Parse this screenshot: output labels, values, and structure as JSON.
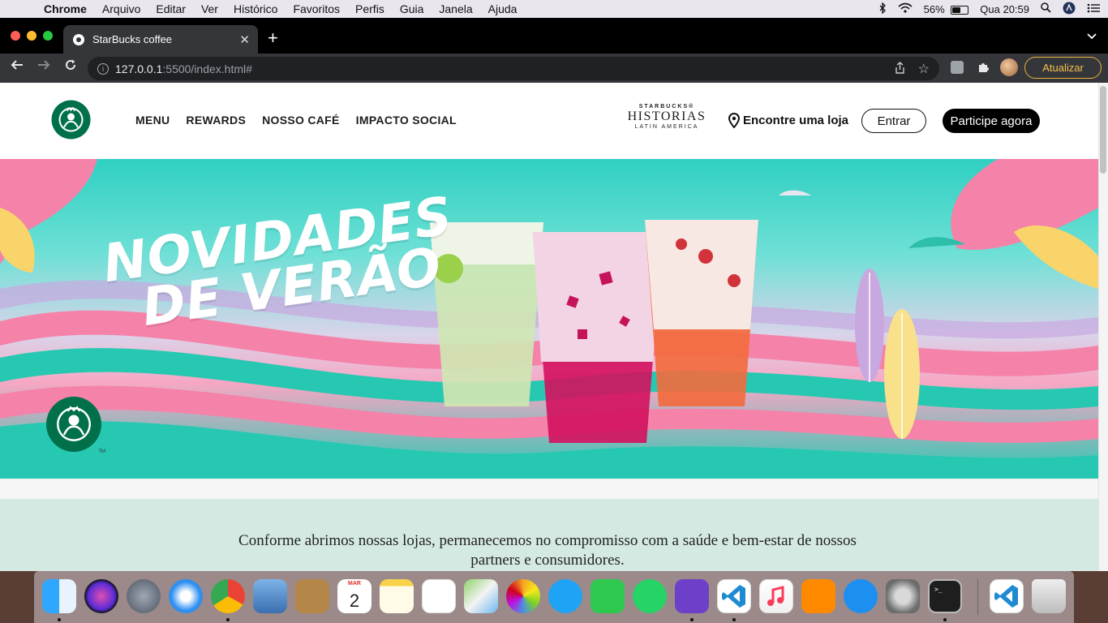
{
  "menubar": {
    "app": "Chrome",
    "items": [
      "Arquivo",
      "Editar",
      "Ver",
      "Histórico",
      "Favoritos",
      "Perfis",
      "Guia",
      "Janela",
      "Ajuda"
    ],
    "battery_percent": "56%",
    "battery_level": 0.56,
    "clock": "Qua 20:59"
  },
  "browser": {
    "tab_title": "StarBucks coffee",
    "url_host": "127.0.0.1",
    "url_path": ":5500/index.html#",
    "update_label": "Atualizar"
  },
  "site": {
    "nav": [
      "MENU",
      "REWARDS",
      "NOSSO CAFÉ",
      "IMPACTO SOCIAL"
    ],
    "historias": {
      "top": "STARBUCKS®",
      "middle": "HISTORIAS",
      "bottom": "LATIN AMERICA"
    },
    "find_store": "Encontre uma loja",
    "login_label": "Entrar",
    "join_label": "Participe agora",
    "hero_line1": "NOVIDADES",
    "hero_line2": "DE VERÃO",
    "notice_text": "Conforme abrimos nossas lojas, permanecemos no compromisso com a saúde e bem-estar de nossos partners e consumidores."
  },
  "dock": {
    "calendar_month": "MAR",
    "calendar_day": "2",
    "apps": [
      "Finder",
      "Siri",
      "Launchpad",
      "Safari",
      "Google Chrome",
      "Preview",
      "Contacts",
      "Calendar",
      "Notes",
      "Reminders",
      "Maps",
      "Photos",
      "Messages",
      "FaceTime",
      "WhatsApp",
      "GitHub Desktop",
      "Visual Studio Code",
      "Music",
      "Books",
      "App Store",
      "System Preferences",
      "Terminal",
      "Visual Studio Code",
      "Trash"
    ]
  },
  "colors": {
    "starbucks_green": "#00704a",
    "hero_teal": "#2fd0c2",
    "hero_pink": "#f582a9",
    "notice_bg": "#d4e9e2",
    "update_amber": "#f2c04c"
  }
}
